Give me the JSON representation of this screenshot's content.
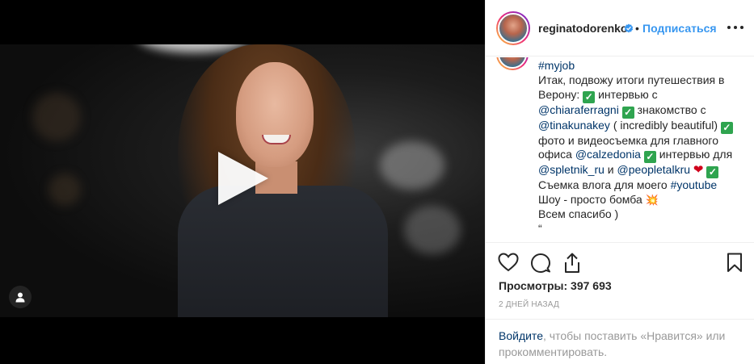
{
  "post": {
    "username": "reginatodorenko",
    "separator": "•",
    "follow_label": "Подписаться",
    "caption": {
      "hashtag_myjob": "#myjob",
      "text1": "Итак, подвожу итоги путешествия в Верону: ",
      "check": "✓",
      "text2": " интервью с ",
      "mention_chiara": "@chiaraferragni",
      "text3": " знакомство с ",
      "mention_tinakunakey": "@tinakunakey",
      "text4": " ( incredibly beautiful) ",
      "text5": " фото и видеосъемка для главного офиса ",
      "mention_calzedonia": "@calzedonia",
      "text6": " интервью для ",
      "mention_spletnik": "@spletnik_ru",
      "text7": " и ",
      "mention_peopletalk": "@peopletalkru",
      "heart": "❤",
      "text8": " Съемка влога для моего ",
      "hashtag_youtube": "#youtube",
      "text9": "Шоу - просто бомба ",
      "boom": "💥",
      "text10": "Всем спасибо )",
      "text11": "“"
    },
    "views": "Просмотры: 397 693",
    "date": "2 дней назад",
    "login_link": "Войдите",
    "login_text": ", чтобы поставить «Нравится» или прокомментировать."
  },
  "icons": {
    "verified": "verified-badge-icon",
    "more": "more-options-icon",
    "like": "heart-icon",
    "comment": "comment-icon",
    "share": "share-icon",
    "save": "bookmark-icon",
    "tag": "user-tag-icon",
    "play": "play-icon"
  },
  "colors": {
    "link": "#003569",
    "follow": "#3897f0",
    "muted": "#999999",
    "check_green": "#2fa44f"
  }
}
